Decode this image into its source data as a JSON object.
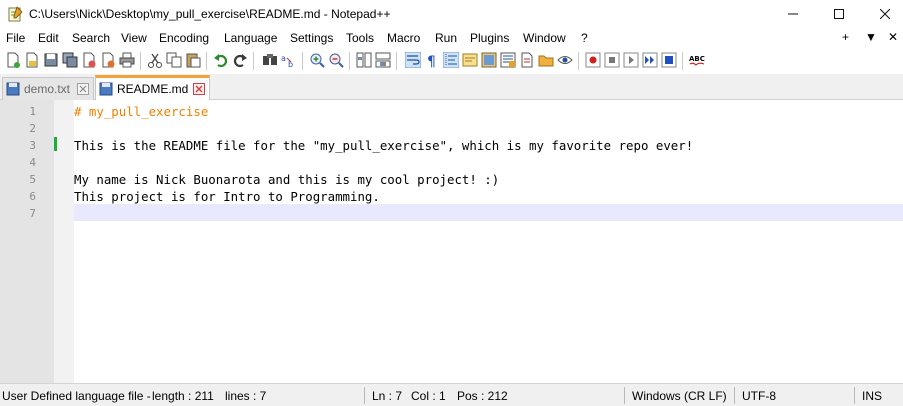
{
  "window": {
    "title": "C:\\Users\\Nick\\Desktop\\my_pull_exercise\\README.md - Notepad++",
    "minimize": "—",
    "maximize": "☐",
    "close": "✕"
  },
  "menu": {
    "items": [
      "File",
      "Edit",
      "Search",
      "View",
      "Encoding",
      "Language",
      "Settings",
      "Tools",
      "Macro",
      "Run",
      "Plugins",
      "Window",
      "?"
    ],
    "right": [
      "+",
      "▼",
      "✕"
    ]
  },
  "tabs": [
    {
      "label": "demo.txt",
      "active": false
    },
    {
      "label": "README.md",
      "active": true
    }
  ],
  "editor": {
    "line_numbers": [
      "1",
      "2",
      "3",
      "4",
      "5",
      "6",
      "7"
    ],
    "lines": [
      "# my_pull_exercise",
      "",
      "This is the README file for the \"my_pull_exercise\", which is my favorite repo ever!",
      "",
      "My name is Nick Buonarota and this is my cool project! :)",
      "This project is for Intro to Programming.",
      ""
    ]
  },
  "status": {
    "filetype": "User Defined language file -",
    "length": "length : 211",
    "lines": "lines : 7",
    "ln": "Ln : 7",
    "col": "Col : 1",
    "pos": "Pos : 212",
    "eol": "Windows (CR LF)",
    "encoding": "UTF-8",
    "mode": "INS"
  },
  "colors": {
    "heading": "#f08000",
    "current_line": "#e8e8ff",
    "active_tab_accent": "#f4a13a",
    "change_marker": "#1fae3a"
  }
}
